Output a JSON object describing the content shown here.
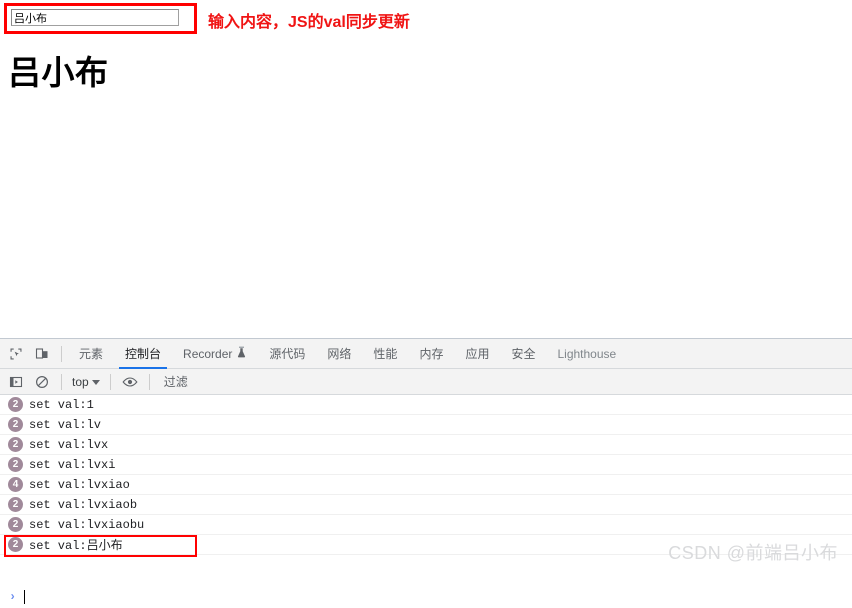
{
  "page": {
    "input": {
      "value": "吕小布",
      "placeholder": ""
    },
    "annotation": "输入内容，JS的val同步更新",
    "heading": "吕小布",
    "accent_red": "#ff0000",
    "annotation_color": "#f01414"
  },
  "devtools": {
    "icons": {
      "inspect": "inspect-element-icon",
      "device": "device-toolbar-icon",
      "sidebar": "console-sidebar-icon",
      "clear": "clear-console-icon",
      "eye": "live-expression-icon",
      "flask": "experiment-flask-icon"
    },
    "tabs": [
      {
        "label": "元素",
        "selected": false,
        "dim": false,
        "icon": null
      },
      {
        "label": "控制台",
        "selected": true,
        "dim": false,
        "icon": null
      },
      {
        "label": "Recorder",
        "selected": false,
        "dim": false,
        "icon": "experiment-flask-icon"
      },
      {
        "label": "源代码",
        "selected": false,
        "dim": false,
        "icon": null
      },
      {
        "label": "网络",
        "selected": false,
        "dim": false,
        "icon": null
      },
      {
        "label": "性能",
        "selected": false,
        "dim": false,
        "icon": null
      },
      {
        "label": "内存",
        "selected": false,
        "dim": false,
        "icon": null
      },
      {
        "label": "应用",
        "selected": false,
        "dim": false,
        "icon": null
      },
      {
        "label": "安全",
        "selected": false,
        "dim": false,
        "icon": null
      },
      {
        "label": "Lighthouse",
        "selected": false,
        "dim": true,
        "icon": null
      }
    ],
    "filter_bar": {
      "context": "top",
      "filter_placeholder": "过滤",
      "filter_value": ""
    },
    "console_messages": [
      {
        "count": "2",
        "text": "set val:1"
      },
      {
        "count": "2",
        "text": "set val:lv"
      },
      {
        "count": "2",
        "text": "set val:lvx"
      },
      {
        "count": "2",
        "text": "set val:lvxi"
      },
      {
        "count": "4",
        "text": "set val:lvxiao"
      },
      {
        "count": "2",
        "text": "set val:lvxiaob"
      },
      {
        "count": "2",
        "text": "set val:lvxiaobu"
      },
      {
        "count": "2",
        "text": "set val:吕小布",
        "highlighted": true
      }
    ],
    "prompt": {
      "arrow": "›",
      "value": ""
    },
    "badge_color": "#a0899a",
    "selected_tab_color": "#1a73e8"
  },
  "watermark": "CSDN @前端吕小布"
}
